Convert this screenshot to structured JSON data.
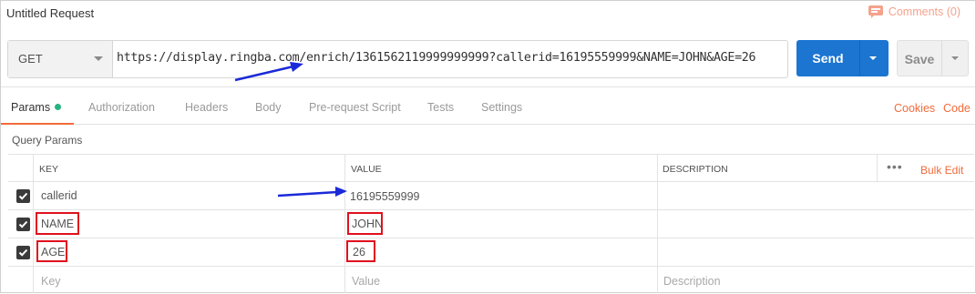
{
  "request": {
    "title": "Untitled Request",
    "comments_label": "Comments (0)",
    "method": "GET",
    "url": "https://display.ringba.com/enrich/1361562119999999999?callerid=16195559999&NAME=JOHN&AGE=26",
    "send_label": "Send",
    "save_label": "Save"
  },
  "tabs": [
    {
      "label": "Params",
      "active": true
    },
    {
      "label": "Authorization"
    },
    {
      "label": "Headers"
    },
    {
      "label": "Body"
    },
    {
      "label": "Pre-request Script"
    },
    {
      "label": "Tests"
    },
    {
      "label": "Settings"
    }
  ],
  "tab_links": {
    "cookies": "Cookies",
    "code": "Code"
  },
  "query_params": {
    "title": "Query Params",
    "headers": {
      "key": "KEY",
      "value": "VALUE",
      "description": "DESCRIPTION"
    },
    "more_label": "•••",
    "bulk_edit_label": "Bulk Edit",
    "rows": [
      {
        "checked": true,
        "key": "callerid",
        "value": "16195559999",
        "description": ""
      },
      {
        "checked": true,
        "key": "NAME",
        "value": "JOHN",
        "description": ""
      },
      {
        "checked": true,
        "key": "AGE",
        "value": "26",
        "description": ""
      }
    ],
    "placeholders": {
      "key": "Key",
      "value": "Value",
      "description": "Description"
    }
  },
  "colors": {
    "accent_orange": "#f26b3a",
    "send_blue": "#1b75d1",
    "highlight_red": "#e0101d",
    "annotation_arrow": "#1a2ad8",
    "active_dot": "#26b47f"
  }
}
